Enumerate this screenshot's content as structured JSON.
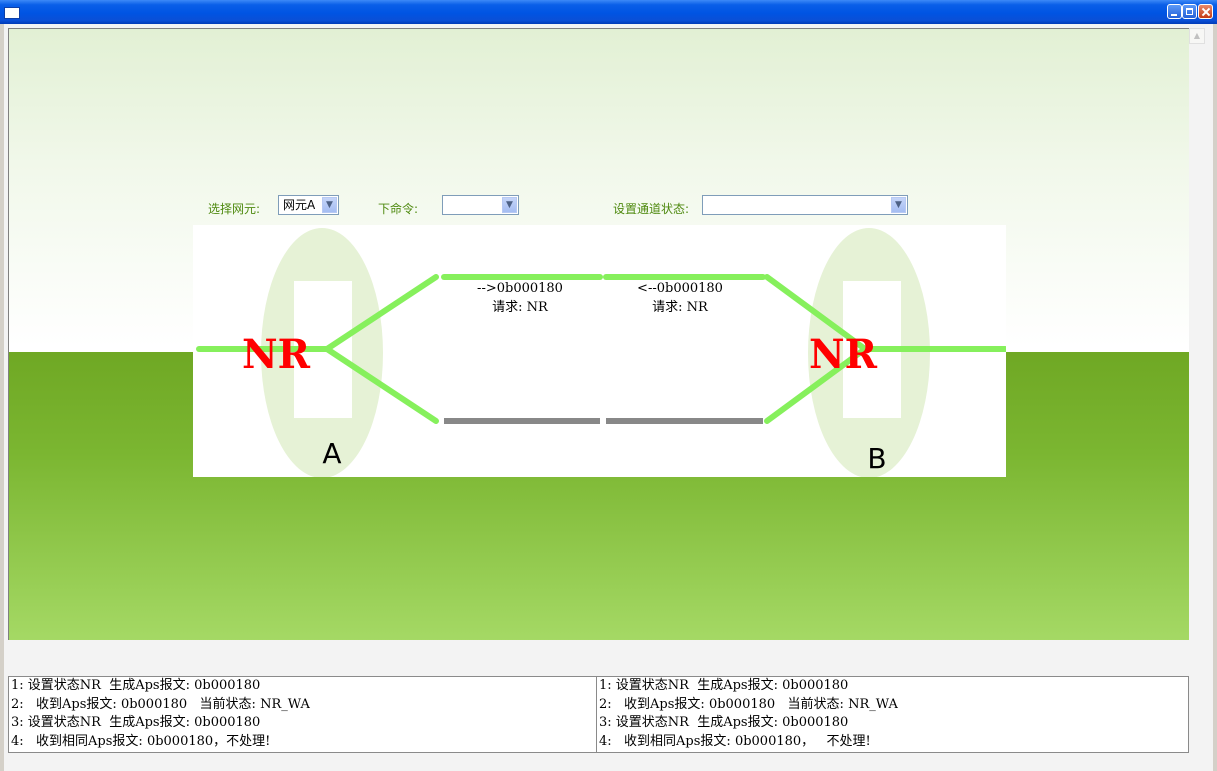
{
  "window": {
    "accent": "#0054e3",
    "controls": [
      "minimize-icon",
      "maximize-icon",
      "close-icon"
    ]
  },
  "controls": {
    "ne_label": "选择网元:",
    "ne_value": "网元A",
    "cmd_label": "下命令:",
    "cmd_value": "",
    "channel_label": "设置通道状态:",
    "channel_value": ""
  },
  "diagram": {
    "node_a": {
      "label": "A",
      "state": "NR"
    },
    "node_b": {
      "label": "B",
      "state": "NR"
    },
    "link_left": {
      "message": "-->0b000180",
      "request": "请求: NR"
    },
    "link_right": {
      "message": "<--0b000180",
      "request": "请求: NR"
    },
    "colors": {
      "active": "#86f05c",
      "standby": "#888888",
      "state_text": "#ff0000",
      "node_halo": "#e6f2d6"
    }
  },
  "log_left": [
    "1: 设置状态NR  生成Aps报文: 0b000180",
    "2:   收到Aps报文: 0b000180   当前状态: NR_WA",
    "3: 设置状态NR  生成Aps报文: 0b000180",
    "4:   收到相同Aps报文: 0b000180，不处理!"
  ],
  "log_right": [
    "1: 设置状态NR  生成Aps报文: 0b000180",
    "2:   收到Aps报文: 0b000180   当前状态: NR_WA",
    "3: 设置状态NR  生成Aps报文: 0b000180",
    "4:   收到相同Aps报文: 0b000180，   不处理!"
  ]
}
